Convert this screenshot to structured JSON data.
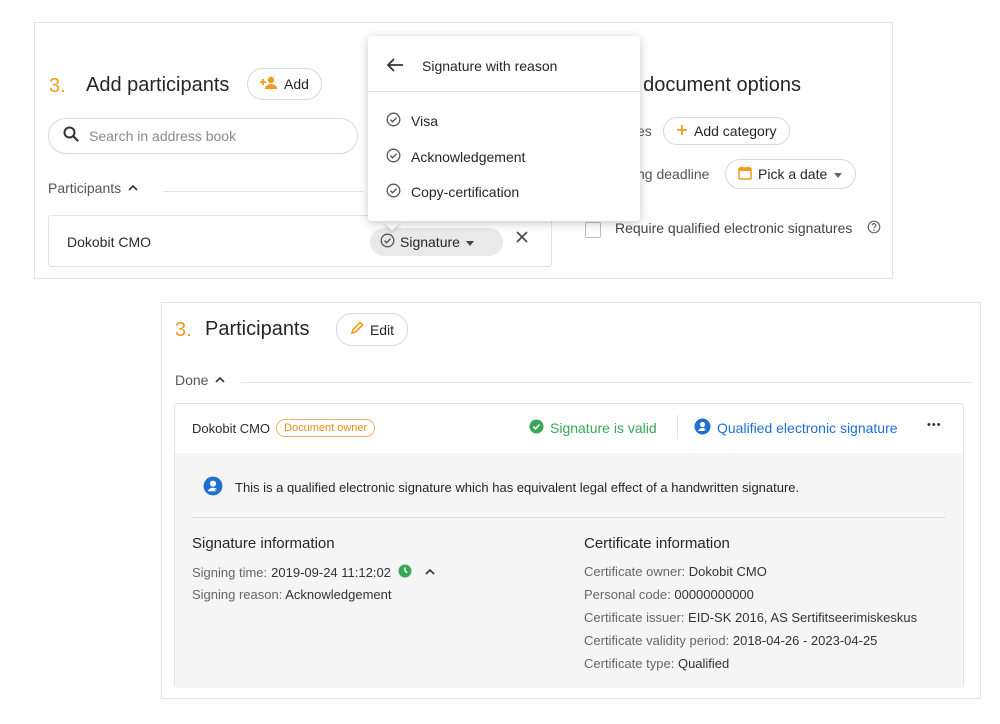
{
  "top": {
    "step_number": "3.",
    "title": "Add participants",
    "add_button": "Add",
    "search_placeholder": "Search in address book",
    "participants_label": "Participants",
    "participant_name": "Dokobit CMO",
    "signature_chip": "Signature",
    "right_title": "t document options",
    "category_label": "es",
    "add_category": "Add category",
    "deadline_label": "ng deadline",
    "pick_date": "Pick a date",
    "require_qes": "Require qualified electronic signatures"
  },
  "dropdown": {
    "header": "Signature with reason",
    "items": [
      "Visa",
      "Acknowledgement",
      "Copy-certification"
    ]
  },
  "bottom": {
    "step_number": "3.",
    "title": "Participants",
    "edit_button": "Edit",
    "done_label": "Done",
    "participant_name": "Dokobit CMO",
    "owner_badge": "Document owner",
    "signature_valid": "Signature is valid",
    "qes_label": "Qualified electronic signature",
    "more": "•••",
    "qes_notice": "This is a qualified electronic signature which has equivalent legal effect of a handwritten signature.",
    "sig_info": {
      "heading": "Signature information",
      "signing_time_label": "Signing time:",
      "signing_time": "2019-09-24 11:12:02",
      "signing_reason_label": "Signing reason:",
      "signing_reason": "Acknowledgement"
    },
    "cert_info": {
      "heading": "Certificate information",
      "owner_label": "Certificate owner:",
      "owner": "Dokobit CMO",
      "code_label": "Personal code:",
      "code": "00000000000",
      "issuer_label": "Certificate issuer:",
      "issuer": "EID-SK 2016, AS Sertifitseerimiskeskus",
      "validity_label": "Certificate validity period:",
      "validity": "2018-04-26 - 2023-04-25",
      "type_label": "Certificate type:",
      "type": "Qualified"
    }
  },
  "colors": {
    "accent": "#f29b1f",
    "valid": "#3aa757",
    "link": "#1f6fd1"
  }
}
